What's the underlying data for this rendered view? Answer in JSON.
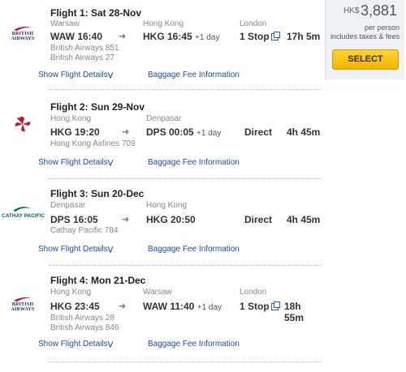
{
  "price": {
    "currency": "HK$",
    "amount": "3,881",
    "per_person": "per person",
    "includes": "includes taxes & fees",
    "select_label": "SELECT"
  },
  "links": {
    "details": "Show Flight Details",
    "baggage": "Baggage Fee Information"
  },
  "flights": [
    {
      "title": "Flight 1:  Sat 28-Nov",
      "airline_logo_text": "BRITISH AIRWAYS",
      "from_city": "Warsaw",
      "to_city": "Hong Kong",
      "via_city": "London",
      "dep": "WAW 16:40",
      "arr": "HKG 16:45",
      "day_offset": "+1 day",
      "carriers": [
        "British Airways 851",
        "British Airways 27"
      ],
      "stops": "1 Stop",
      "duration": "17h 5m"
    },
    {
      "title": "Flight 2:  Sun 29-Nov",
      "from_city": "Hong Kong",
      "to_city": "Denpasar",
      "dep": "HKG 19:20",
      "arr": "DPS 00:05",
      "day_offset": "+1 day",
      "carriers": [
        "Hong Kong Airlines 709"
      ],
      "stops": "Direct",
      "duration": "4h 45m"
    },
    {
      "title": "Flight 3:  Sun 20-Dec",
      "airline_logo_text": "CATHAY PACIFIC",
      "from_city": "Denpasar",
      "to_city": "Hong Kong",
      "dep": "DPS 16:05",
      "arr": "HKG 20:50",
      "carriers": [
        "Cathay Pacific 784"
      ],
      "stops": "Direct",
      "duration": "4h 45m"
    },
    {
      "title": "Flight 4:  Mon 21-Dec",
      "airline_logo_text": "BRITISH AIRWAYS",
      "from_city": "Hong Kong",
      "to_city": "Warsaw",
      "via_city": "London",
      "dep": "HKG 23:45",
      "arr": "WAW 11:40",
      "day_offset": "+1 day",
      "carriers": [
        "British Airways 28",
        "British Airways 846"
      ],
      "stops": "1 Stop",
      "duration": "18h 55m"
    }
  ],
  "icons": {
    "arrow": "right-arrow-icon",
    "popup": "external-window-icon",
    "chevron": "double-chevron-down-icon"
  },
  "colors": {
    "link": "#1a4fa3",
    "select_button": "#f4b400",
    "price_panel": "#eef1f5"
  }
}
